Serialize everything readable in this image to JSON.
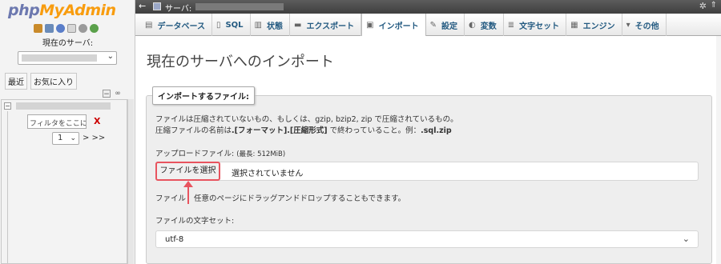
{
  "nav": {
    "logo_php": "php",
    "logo_myadmin": "MyAdmin",
    "quick_icons": [
      "home-icon",
      "sql-icon",
      "help-icon",
      "docs-icon",
      "settings-icon",
      "reload-icon"
    ],
    "server_label": "現在のサーバ:",
    "tabs": [
      "最近",
      "お気に入り"
    ],
    "filter_value": "フィルタをここに...",
    "clear_label": "X",
    "page_number": "1",
    "page_next": "> >>"
  },
  "topbar": {
    "crumb_label": "サーバ:"
  },
  "menu": {
    "tabs": [
      {
        "icon": "database-icon",
        "label": "データベース"
      },
      {
        "icon": "sql-icon",
        "label": "SQL"
      },
      {
        "icon": "status-icon",
        "label": "状態"
      },
      {
        "icon": "export-icon",
        "label": "エクスポート"
      },
      {
        "icon": "import-icon",
        "label": "インポート",
        "active": true
      },
      {
        "icon": "wrench-icon",
        "label": "設定"
      },
      {
        "icon": "variables-icon",
        "label": "変数"
      },
      {
        "icon": "charset-icon",
        "label": "文字セット"
      },
      {
        "icon": "engine-icon",
        "label": "エンジン"
      },
      {
        "icon": "chevron-down-icon",
        "label": "その他"
      }
    ]
  },
  "main": {
    "title": "現在のサーバへのインポート",
    "legend": "インポートするファイル:",
    "desc_line1": "ファイルは圧縮されていないもの、もしくは、gzip, bzip2, zip で圧縮されているもの。",
    "desc_line2_prefix": "圧縮ファイルの名前は",
    "desc_line2_bold": ".[フォーマット].[圧縮形式]",
    "desc_line2_mid": " で終わっていること。例：",
    "desc_line2_example": ".sql.zip",
    "upload_label": "アップロードファイル:",
    "upload_limit": "(最長: 512MiB)",
    "file_button": "ファイルを選択",
    "file_status": "選択されていません",
    "drag_hint_prefix": "ファイル",
    "drag_hint_suffix": "任意のページにドラッグアンドドロップすることもできます。",
    "charset_label": "ファイルの文字セット:",
    "charset_value": "utf-8"
  },
  "colors": {
    "accent_highlight": "#e8545f",
    "tab_text": "#235a81",
    "topbar": "#4a4a4a"
  }
}
